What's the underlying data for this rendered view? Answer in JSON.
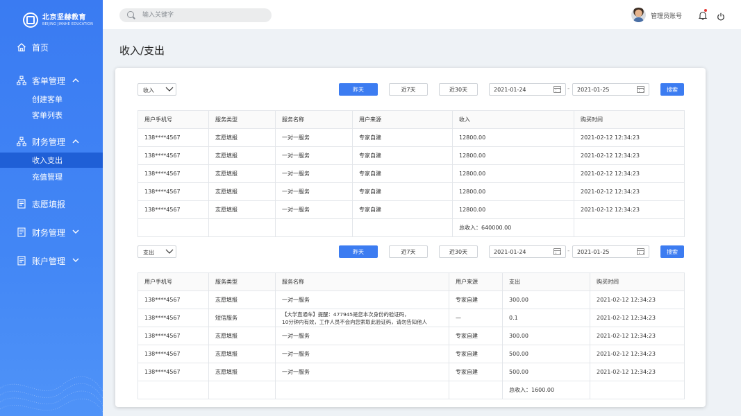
{
  "brand": {
    "name_cn": "北京坚赫教育",
    "name_en": "BEIJING JIANHE EDUCATION"
  },
  "sidebar": {
    "items": [
      {
        "label": "首页",
        "icon": "home-icon"
      },
      {
        "label": "客单管理",
        "icon": "org-chart-icon",
        "expanded": true,
        "children": [
          {
            "label": "创建客单"
          },
          {
            "label": "客单列表"
          }
        ]
      },
      {
        "label": "财务管理",
        "icon": "org-chart-icon",
        "expanded": true,
        "children": [
          {
            "label": "收入支出",
            "active": true
          },
          {
            "label": "充值管理"
          }
        ]
      },
      {
        "label": "志愿填报",
        "icon": "document-icon"
      },
      {
        "label": "财务管理",
        "icon": "document-icon",
        "expanded": false
      },
      {
        "label": "账户管理",
        "icon": "document-icon",
        "expanded": false
      }
    ]
  },
  "header": {
    "search_placeholder": "输入关键字",
    "account_label": "管理员账号"
  },
  "page": {
    "title": "收入/支出"
  },
  "income": {
    "type_select": "收入",
    "btn_yesterday": "昨天",
    "btn_7days": "近7天",
    "btn_30days": "近30天",
    "date_from": "2021-01-24",
    "date_to": "2021-01-25",
    "date_sep": "-",
    "search_btn": "搜索",
    "columns": [
      "用户手机号",
      "服务类型",
      "服务名称",
      "用户来源",
      "收入",
      "购买时间"
    ],
    "rows": [
      [
        "138****4567",
        "志愿填报",
        "一对一服务",
        "专家自建",
        "12800.00",
        "2021-02-12 12:34:23"
      ],
      [
        "138****4567",
        "志愿填报",
        "一对一服务",
        "专家自建",
        "12800.00",
        "2021-02-12 12:34:23"
      ],
      [
        "138****4567",
        "志愿填报",
        "一对一服务",
        "专家自建",
        "12800.00",
        "2021-02-12 12:34:23"
      ],
      [
        "138****4567",
        "志愿填报",
        "一对一服务",
        "专家自建",
        "12800.00",
        "2021-02-12 12:34:23"
      ],
      [
        "138****4567",
        "志愿填报",
        "一对一服务",
        "专家自建",
        "12800.00",
        "2021-02-12 12:34:23"
      ]
    ],
    "total": "总收入：640000.00"
  },
  "expense": {
    "type_select": "支出",
    "btn_yesterday": "昨天",
    "btn_7days": "近7天",
    "btn_30days": "近30天",
    "date_from": "2021-01-24",
    "date_to": "2021-01-25",
    "date_sep": "-",
    "search_btn": "搜索",
    "columns": [
      "用户手机号",
      "服务类型",
      "服务名称",
      "用户来源",
      "支出",
      "购买时间"
    ],
    "rows": [
      [
        "138****4567",
        "志愿填报",
        "一对一服务",
        "专家自建",
        "300.00",
        "2021-02-12 12:34:23"
      ],
      [
        "138****4567",
        "短信服务",
        "【大学直通车】提醒：477945是您本次身份的验证码，\n10分钟内有效，工作人员不会向您索取此验证码，请勿告知他人",
        "—",
        "0.1",
        "2021-02-12 12:34:23"
      ],
      [
        "138****4567",
        "志愿填报",
        "一对一服务",
        "专家自建",
        "300.00",
        "2021-02-12 12:34:23"
      ],
      [
        "138****4567",
        "志愿填报",
        "一对一服务",
        "专家自建",
        "500.00",
        "2021-02-12 12:34:23"
      ],
      [
        "138****4567",
        "志愿填报",
        "一对一服务",
        "专家自建",
        "500.00",
        "2021-02-12 12:34:23"
      ]
    ],
    "total": "总收入：1600.00"
  }
}
